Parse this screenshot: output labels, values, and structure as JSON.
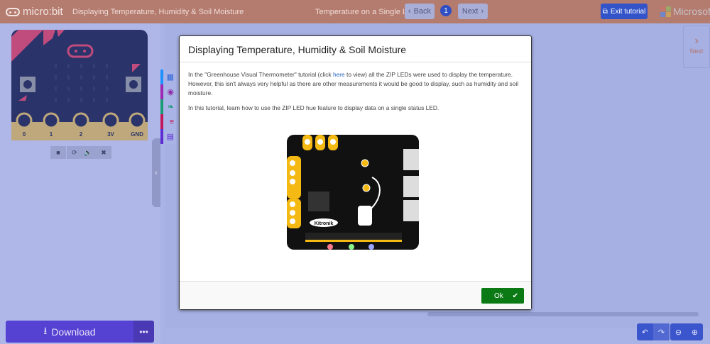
{
  "header": {
    "logo_text": "micro:bit",
    "tutorial_title": "Displaying Temperature, Humidity & Soil Moisture",
    "step_title": "Temperature on a Single LED",
    "back_label": "Back",
    "step_number": "1",
    "next_label": "Next",
    "exit_label": "Exit tutorial",
    "brand": "Microsoft"
  },
  "simulator": {
    "pins": [
      "0",
      "1",
      "2",
      "3V",
      "GND"
    ],
    "button_a": "A",
    "button_b": "B",
    "controls": [
      "stop-icon",
      "restart-icon",
      "sound-icon",
      "fullscreen-icon"
    ]
  },
  "toolbox": {
    "colors": [
      "#1e90ff",
      "#9c27b0",
      "#1b9a76",
      "#c2185b",
      "#5c2dd5"
    ]
  },
  "workspace": {
    "next_label": "Next"
  },
  "modal": {
    "title": "Displaying Temperature, Humidity & Soil Moisture",
    "p1_before": "In the \"Greenhouse Visual Thermometer\" tutorial (click ",
    "p1_link": "here",
    "p1_after": " to view) all the ZIP LEDs were used to display the temperature. However, this isn't always very helpful as there are other measurements it would be good to display, such as humidity and soil moisture.",
    "p2": "In this tutorial, learn how to use the ZIP LED hue feature to display data on a single status LED.",
    "image_logo": "Kitronik",
    "ok_label": "Ok"
  },
  "footer": {
    "download_label": "Download",
    "more_label": "•••"
  },
  "colors": {
    "header": "#b47b6f",
    "download": "#5542d2",
    "ok": "#0b7a14",
    "exit": "#3353c9"
  }
}
